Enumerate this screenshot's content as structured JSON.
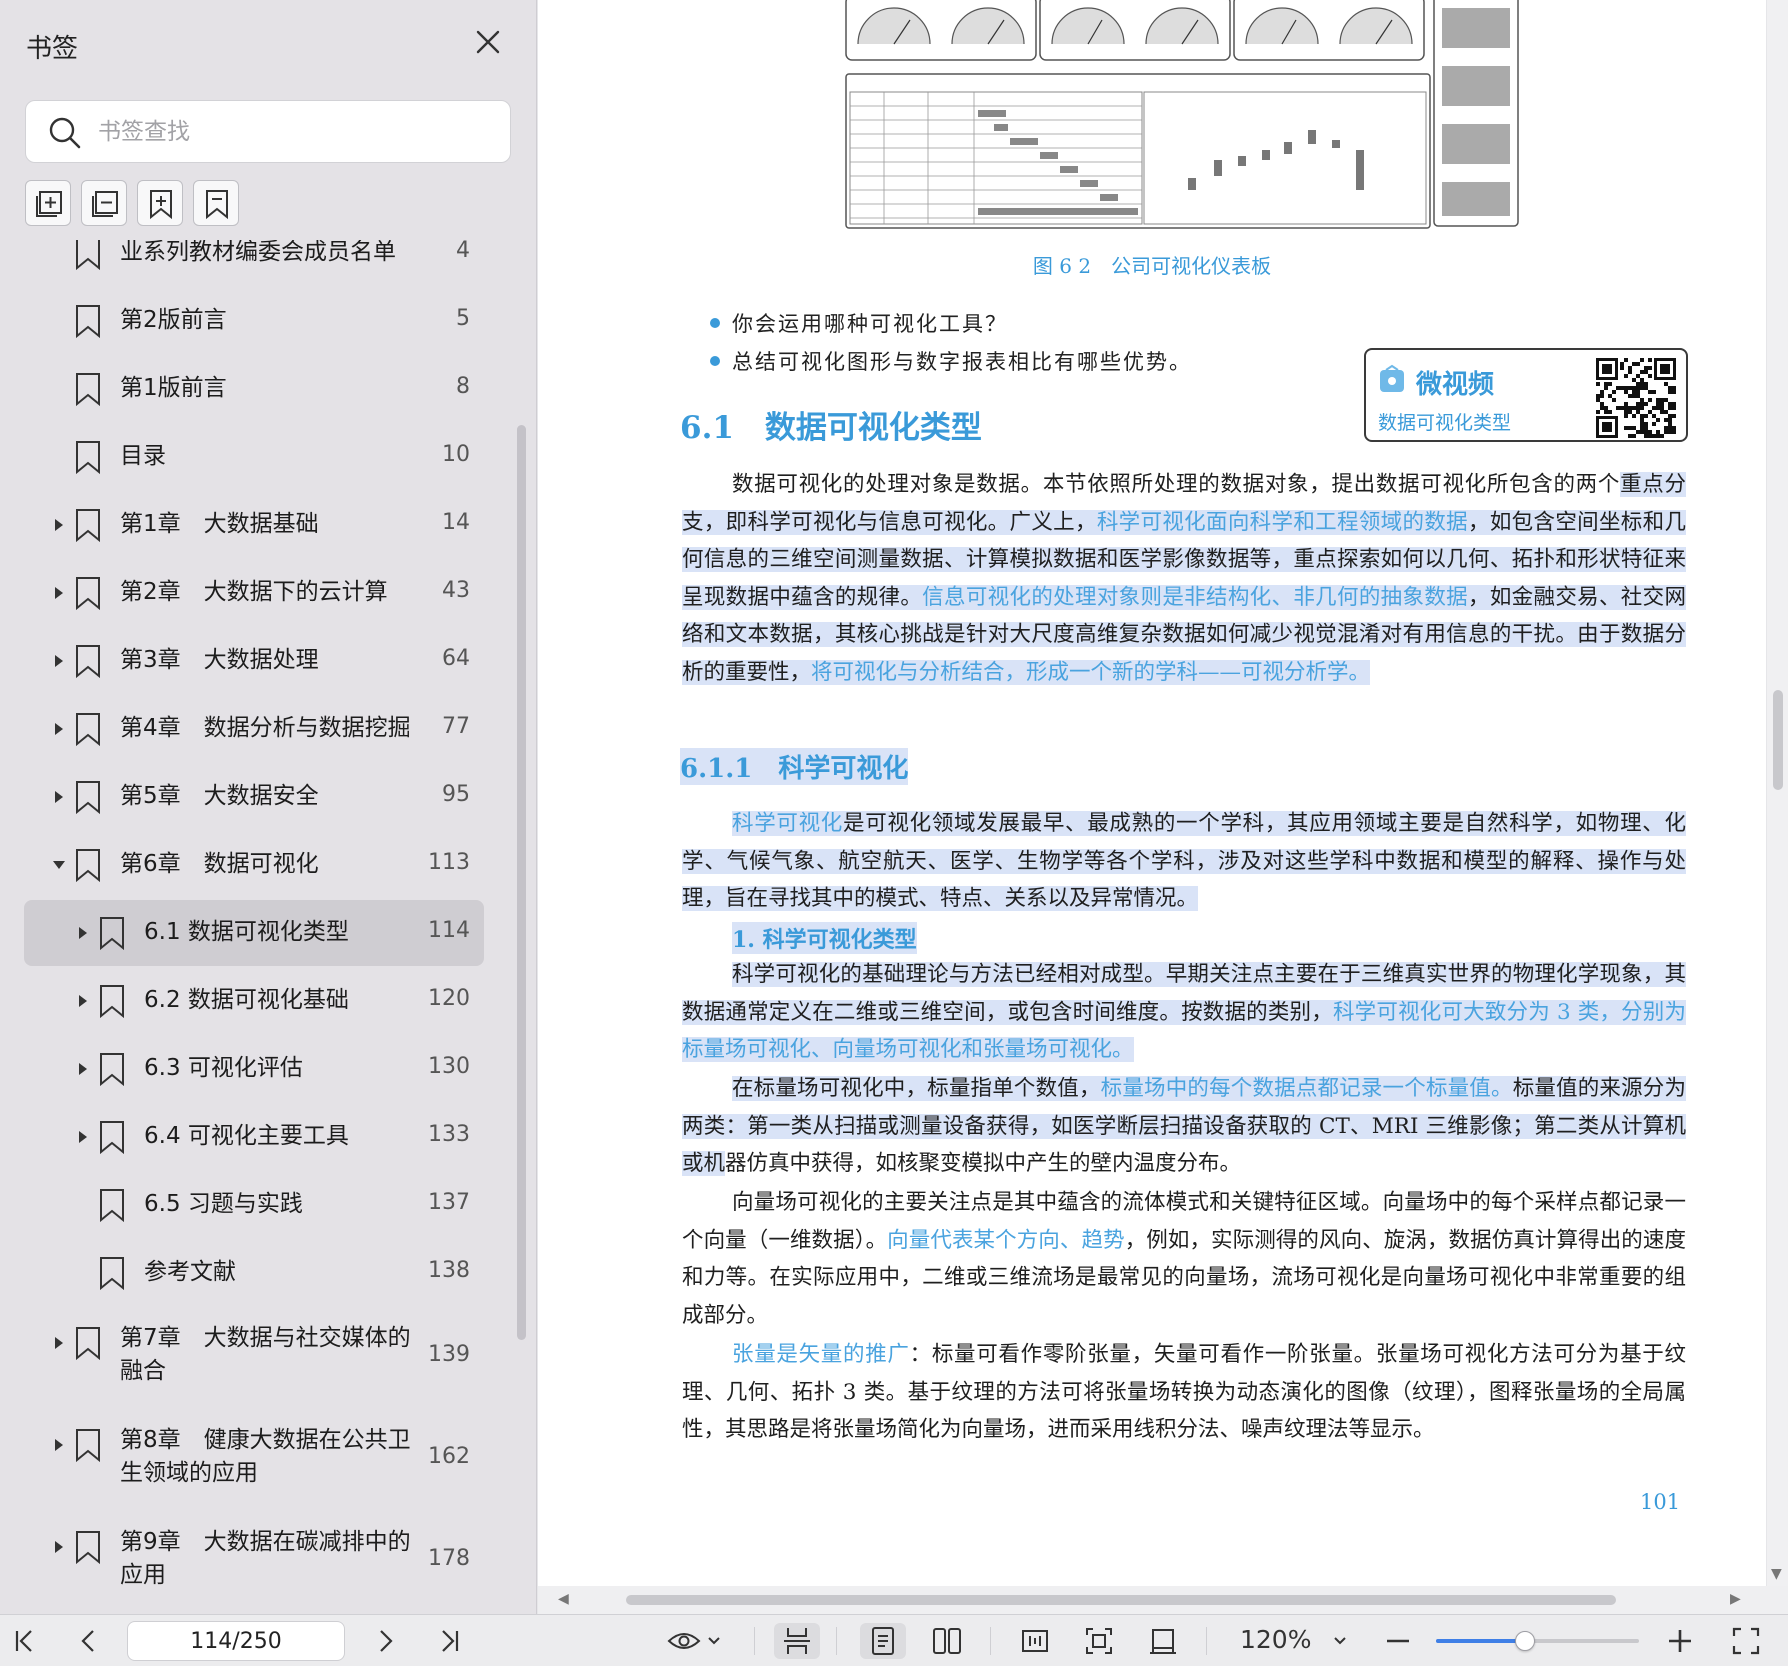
{
  "sidebar": {
    "title": "书签",
    "search_placeholder": "书签查找",
    "items": [
      {
        "label": "业系列教材编委会成员名单",
        "page": "4",
        "level": 0
      },
      {
        "label": "第2版前言",
        "page": "5",
        "level": 0
      },
      {
        "label": "第1版前言",
        "page": "8",
        "level": 0
      },
      {
        "label": "目录",
        "page": "10",
        "level": 0
      },
      {
        "label": "第1章　大数据基础",
        "page": "14",
        "level": 0
      },
      {
        "label": "第2章　大数据下的云计算",
        "page": "43",
        "level": 0
      },
      {
        "label": "第3章　大数据处理",
        "page": "64",
        "level": 0
      },
      {
        "label": "第4章　数据分析与数据挖掘",
        "page": "77",
        "level": 0
      },
      {
        "label": "第5章　大数据安全",
        "page": "95",
        "level": 0
      },
      {
        "label": "第6章　数据可视化",
        "page": "113",
        "level": 0
      },
      {
        "label": "6.1  数据可视化类型",
        "page": "114",
        "level": 1
      },
      {
        "label": "6.2  数据可视化基础",
        "page": "120",
        "level": 1
      },
      {
        "label": "6.3  可视化评估",
        "page": "130",
        "level": 1
      },
      {
        "label": "6.4  可视化主要工具",
        "page": "133",
        "level": 1
      },
      {
        "label": "6.5  习题与实践",
        "page": "137",
        "level": 1
      },
      {
        "label": "参考文献",
        "page": "138",
        "level": 1
      },
      {
        "label": "第7章　大数据与社交媒体的",
        "label2": "融合",
        "page": "139",
        "level": 0
      },
      {
        "label": "第8章　健康大数据在公共卫",
        "label2": "生领域的应用",
        "page": "162",
        "level": 0
      },
      {
        "label": "第9章　大数据在碳减排中的",
        "label2": "应用",
        "page": "178",
        "level": 0
      }
    ]
  },
  "document": {
    "figure_caption": "图 6  2　公司可视化仪表板",
    "bullets": [
      "你会运用哪种可视化工具？",
      "总结可视化图形与数字报表相比有哪些优势。"
    ],
    "video": {
      "title": "微视频",
      "subtitle": "数据可视化类型"
    },
    "section_6_1": "6.1　数据可视化类型",
    "p1": {
      "a": "数据可视化的处理对象是数据。本节依照所处理的数据对象，提出数据可视化所包含的两个",
      "b": "重点分支，即科学可视化与信息可视化。广义上，",
      "c": "科学可视化面向科学和工程领域的数据",
      "d": "，如包含空间坐标和几何信息的三维空间测量数据、计算模拟数据和医学影像数据等，重点探索如何以几何、拓扑和形状特征来呈现数据中蕴含的规律。",
      "e": "信息可视化的处理对象则是非结构化、非几何的抽象数据",
      "f": "，如金融交易、社交网络和文本数据，其核心挑战是针对大尺度高维复杂数据如何减少视觉混淆对有用信息的干扰。由于数据分析的重要性，",
      "g": "将可视化与分析结合，形成一个新的学科——可视分析学。"
    },
    "section_6_1_1": "6.1.1　科学可视化",
    "p2": {
      "a": "科学可视化",
      "b": "是可视化领域发展最早、最成熟的一个学科，其应用领域主要是自然科学，如物理、化学、气候气象、航空航天、医学、生物学等各个学科，涉及对这些学科中数据和模型的解释、操作与处理，旨在寻找其中的模式、特点、关系以及异常情况。"
    },
    "subheading_1": "1.  科学可视化类型",
    "p3": {
      "a": "科学可视化的基础理论与方法已经相对成型。早期关注点主要在于三维真实世界的物理化学现象，其数据通常定义在二维或三维空间，或包含时间维度。按数据的类别，",
      "b": "科学可视化可大致分为 3 类，分别为标量场可视化、向量场可视化和张量场可视化。"
    },
    "p4": {
      "a": "在标量场可视化中，标量指单个数值，",
      "b": "标量场中的每个数据点都记录一个标量值。",
      "c": "标量值的来源分为两类：第一类从扫描或测量设备获得，如医学断层扫描设备获取的 CT、MRI 三维影像；第二类从计算机或机",
      "d": "器仿真中获得，如核聚变模拟中产生的壁内温度分布。"
    },
    "p5": {
      "a": "向量场可视化的主要关注点是其中蕴含的流体模式和关键特征区域。向量场中的每个采样点都记录一个向量（一维数据）。",
      "b": "向量代表某个方向、趋势",
      "c": "，例如，实际测得的风向、旋涡，数据仿真计算得出的速度和力等。在实际应用中，二维或三维流场是最常见的向量场，流场可视化是向量场可视化中非常重要的组成部分。"
    },
    "p6": {
      "a": "张量是矢量的推广",
      "b": "：标量可看作零阶张量，矢量可看作一阶张量。张量场可视化方法可分为基于纹理、几何、拓扑 3 类。基于纹理的方法可将张量场转换为动态演化的图像（纹理），图释张量场的全局属性，其思路是将张量场简化为向量场，进而采用线积分法、噪声纹理法等显示。"
    },
    "page_number": "101"
  },
  "toolbar": {
    "page_indicator": "114/250",
    "zoom": "120%",
    "zoom_slider_fraction": 0.44
  },
  "colors": {
    "accent": "#3a9ad9",
    "highlight": "#d9e3f7",
    "sidebar_bg": "#e4e2e6",
    "active_item": "#cfcdd2"
  }
}
